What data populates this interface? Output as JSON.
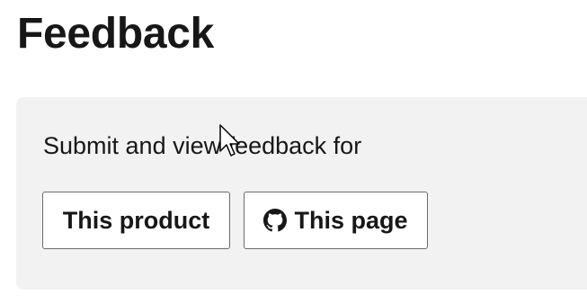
{
  "page": {
    "title": "Feedback"
  },
  "feedback_panel": {
    "prompt": "Submit and view feedback for",
    "buttons": {
      "product_label": "This product",
      "page_label": "This page",
      "page_icon": "github-icon"
    }
  },
  "colors": {
    "panel_background": "#f2f2f2",
    "button_border": "#6b6b6b",
    "text": "#171717"
  }
}
